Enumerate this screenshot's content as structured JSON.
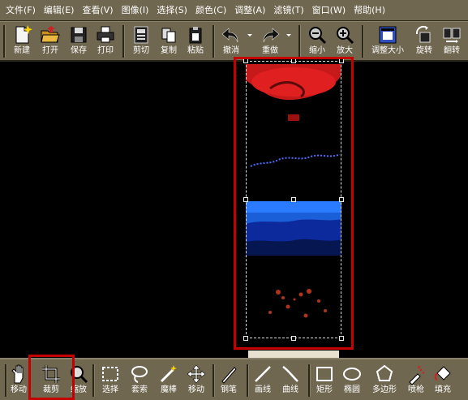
{
  "menu": [
    {
      "label": "文件(F)"
    },
    {
      "label": "编辑(E)"
    },
    {
      "label": "查看(V)"
    },
    {
      "label": "图像(I)"
    },
    {
      "label": "选择(S)"
    },
    {
      "label": "颜色(C)"
    },
    {
      "label": "调整(A)"
    },
    {
      "label": "滤镜(T)"
    },
    {
      "label": "窗口(W)"
    },
    {
      "label": "帮助(H)"
    }
  ],
  "toolbar": {
    "new": "新建",
    "open": "打开",
    "save": "保存",
    "print": "打印",
    "cut": "剪切",
    "copy": "复制",
    "paste": "粘贴",
    "undo": "撤消",
    "redo": "重做",
    "zoom_out": "缩小",
    "zoom_in": "放大",
    "resize": "调整大小",
    "rotate": "旋转",
    "flip": "翻转"
  },
  "tools": {
    "move": "移动",
    "crop": "裁剪",
    "zoom": "缩放",
    "select": "选择",
    "lasso": "套索",
    "wand": "魔棒",
    "drag": "移动",
    "pen": "钢笔",
    "line": "画线",
    "curve": "曲线",
    "rect": "矩形",
    "ellipse": "椭圆",
    "polygon": "多边形",
    "spray": "喷枪",
    "fill": "填充"
  },
  "colors": {
    "ui_bg": "#6f6750",
    "highlight": "#c40000",
    "canvas_bg": "#000000"
  },
  "state": {
    "active_tool": "crop"
  }
}
